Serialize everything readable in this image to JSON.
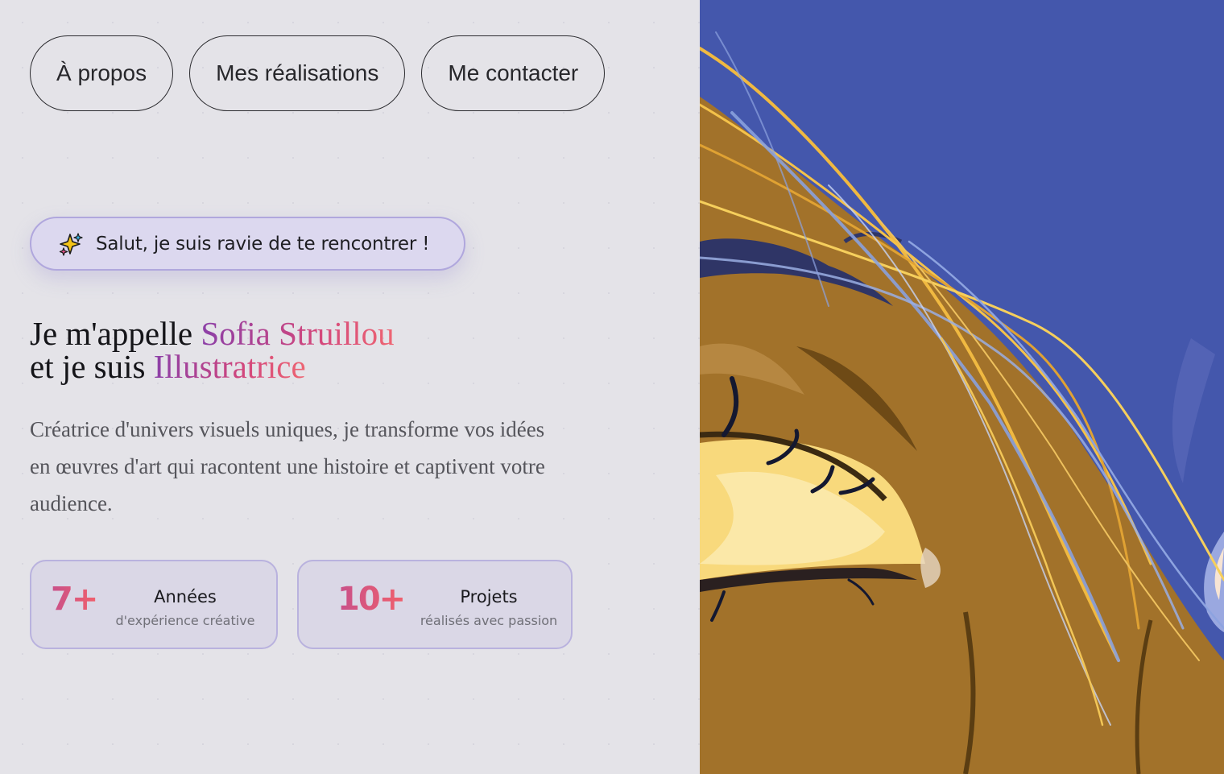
{
  "nav": {
    "items": [
      {
        "label": "À propos"
      },
      {
        "label": "Mes réalisations"
      },
      {
        "label": "Me contacter"
      }
    ]
  },
  "hero": {
    "greeting": "Salut, je suis ravie de te rencontrer !",
    "greeting_icon": "sparkles-icon",
    "line1_prefix": "Je m'appelle ",
    "name": "Sofia Struillou",
    "line2_prefix": "et je suis ",
    "role": "Illustratrice",
    "description": "Créatrice d'univers visuels uniques, je transforme vos idées en œuvres d'art qui racontent une histoire et captivent votre audience."
  },
  "stats": [
    {
      "value": "7+",
      "label": "Années",
      "sub": "d'expérience créative"
    },
    {
      "value": "10+",
      "label": "Projets",
      "sub": "réalisés avec passion"
    }
  ],
  "colors": {
    "background": "#e4e3e8",
    "accent_gradient_start": "#8b3fa8",
    "accent_gradient_end": "#ee6673",
    "illustration_background": "#4457ac",
    "greeting_border": "#b0a7dd"
  }
}
